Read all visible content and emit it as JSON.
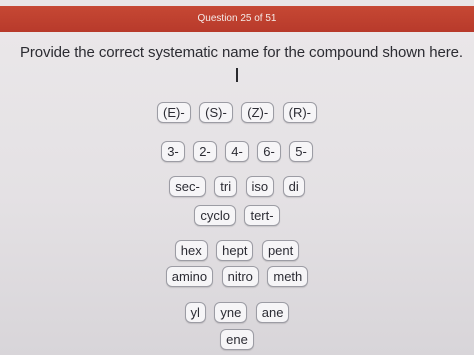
{
  "header": {
    "title": "Question 25 of 51"
  },
  "question": {
    "text": "Provide the correct systematic name for the compound shown here."
  },
  "tiles": {
    "row1": [
      "(E)-",
      "(S)-",
      "(Z)-",
      "(R)-"
    ],
    "row2": [
      "3-",
      "2-",
      "4-",
      "6-",
      "5-"
    ],
    "row3": [
      "sec-",
      "tri",
      "iso",
      "di"
    ],
    "row4": [
      "cyclo",
      "tert-"
    ],
    "row5": [
      "hex",
      "hept",
      "pent"
    ],
    "row6": [
      "amino",
      "nitro",
      "meth"
    ],
    "row7": [
      "yl",
      "yne",
      "ane"
    ],
    "row8": [
      "ene"
    ]
  }
}
